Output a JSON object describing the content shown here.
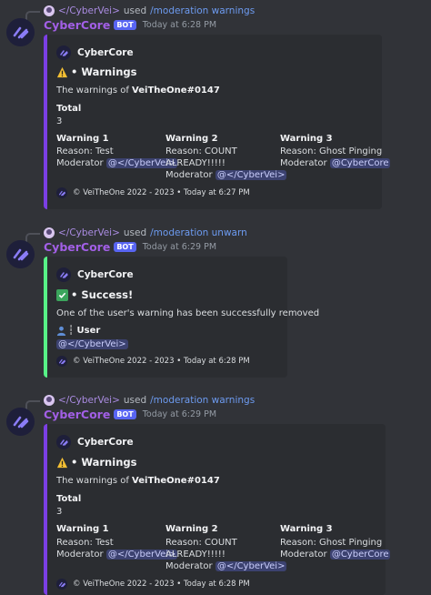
{
  "colors": {
    "background": "#313338",
    "embed_bg": "#2b2d31",
    "purple_accent": "#7b3fe4",
    "green_accent": "#57f287",
    "bot_badge": "#5865f2",
    "username": "#a25fe6",
    "command": "#6d9bf0",
    "mention_bg": "#3c4270"
  },
  "messages": [
    {
      "reply_user": "</CyberVei>",
      "reply_used": "used",
      "reply_command": "/moderation warnings",
      "author": "CyberCore",
      "bot_tag": "BOT",
      "timestamp": "Today at 6:28 PM",
      "embed": {
        "author": "CyberCore",
        "title": "• Warnings",
        "title_icon": "warning-icon",
        "description_prefix": "The warnings of",
        "description_target": "VeiTheOne#0147",
        "total_label": "Total",
        "total_value": "3",
        "fields": [
          {
            "name": "Warning 1",
            "reason": "Reason: Test",
            "reason_cont": "",
            "moderator_label": "Moderator",
            "moderator": "@</CyberVei>"
          },
          {
            "name": "Warning 2",
            "reason": "Reason: COUNT",
            "reason_cont": "ALREADY!!!!!",
            "moderator_label": "Moderator",
            "moderator": "@</CyberVei>"
          },
          {
            "name": "Warning 3",
            "reason": "Reason: Ghost Pinging",
            "reason_cont": "",
            "moderator_label": "Moderator",
            "moderator": "@CyberCore"
          }
        ],
        "footer": "© VeiTheOne 2022 - 2023 • Today at 6:27 PM"
      }
    },
    {
      "reply_user": "</CyberVei>",
      "reply_used": "used",
      "reply_command": "/moderation unwarn",
      "author": "CyberCore",
      "bot_tag": "BOT",
      "timestamp": "Today at 6:29 PM",
      "embed": {
        "author": "CyberCore",
        "title": "• Success!",
        "title_icon": "check-icon",
        "description": "One of the user's warning has been successfully removed",
        "user_label": "┆ User",
        "user_mention": "@</CyberVei>",
        "footer": "© VeiTheOne 2022 - 2023 • Today at 6:28 PM"
      }
    },
    {
      "reply_user": "</CyberVei>",
      "reply_used": "used",
      "reply_command": "/moderation warnings",
      "author": "CyberCore",
      "bot_tag": "BOT",
      "timestamp": "Today at 6:29 PM",
      "embed": {
        "author": "CyberCore",
        "title": "• Warnings",
        "title_icon": "warning-icon",
        "description_prefix": "The warnings of",
        "description_target": "VeiTheOne#0147",
        "total_label": "Total",
        "total_value": "3",
        "fields": [
          {
            "name": "Warning 1",
            "reason": "Reason: Test",
            "reason_cont": "",
            "moderator_label": "Moderator",
            "moderator": "@</CyberVei>"
          },
          {
            "name": "Warning 2",
            "reason": "Reason: COUNT",
            "reason_cont": "ALREADY!!!!!",
            "moderator_label": "Moderator",
            "moderator": "@</CyberVei>"
          },
          {
            "name": "Warning 3",
            "reason": "Reason: Ghost Pinging",
            "reason_cont": "",
            "moderator_label": "Moderator",
            "moderator": "@CyberCore"
          }
        ],
        "footer": "© VeiTheOne 2022 - 2023 • Today at 6:28 PM"
      }
    }
  ]
}
